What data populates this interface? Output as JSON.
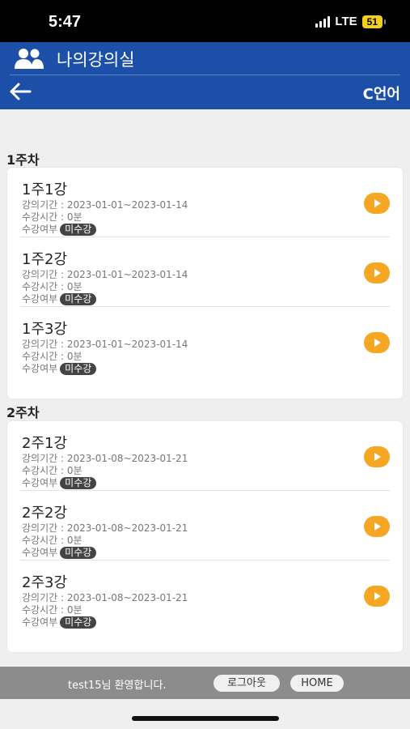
{
  "status_bar": {
    "time": "5:47",
    "network": "LTE",
    "battery": "51"
  },
  "header": {
    "title": "나의강의실",
    "language": "C언어"
  },
  "weeks": [
    {
      "title": "1주차",
      "lectures": [
        {
          "title": "1주1강",
          "period": "강의기간 : 2023-01-01~2023-01-14",
          "time": "수강시간 : 0분",
          "status_label": "수강여부",
          "status": "미수강"
        },
        {
          "title": "1주2강",
          "period": "강의기간 : 2023-01-01~2023-01-14",
          "time": "수강시간 : 0분",
          "status_label": "수강여부",
          "status": "미수강"
        },
        {
          "title": "1주3강",
          "period": "강의기간 : 2023-01-01~2023-01-14",
          "time": "수강시간 : 0분",
          "status_label": "수강여부",
          "status": "미수강"
        }
      ]
    },
    {
      "title": "2주차",
      "lectures": [
        {
          "title": "2주1강",
          "period": "강의기간 : 2023-01-08~2023-01-21",
          "time": "수강시간 : 0분",
          "status_label": "수강여부",
          "status": "미수강"
        },
        {
          "title": "2주2강",
          "period": "강의기간 : 2023-01-08~2023-01-21",
          "time": "수강시간 : 0분",
          "status_label": "수강여부",
          "status": "미수강"
        },
        {
          "title": "2주3강",
          "period": "강의기간 : 2023-01-08~2023-01-21",
          "time": "수강시간 : 0분",
          "status_label": "수강여부",
          "status": "미수강"
        }
      ]
    }
  ],
  "footer": {
    "welcome": "test15님 환영합니다.",
    "logout": "로그아웃",
    "home": "HOME"
  },
  "colors": {
    "header": "#1c4fa7",
    "play": "#f5a623",
    "badge": "#444444",
    "footer": "#8c8c8c"
  }
}
